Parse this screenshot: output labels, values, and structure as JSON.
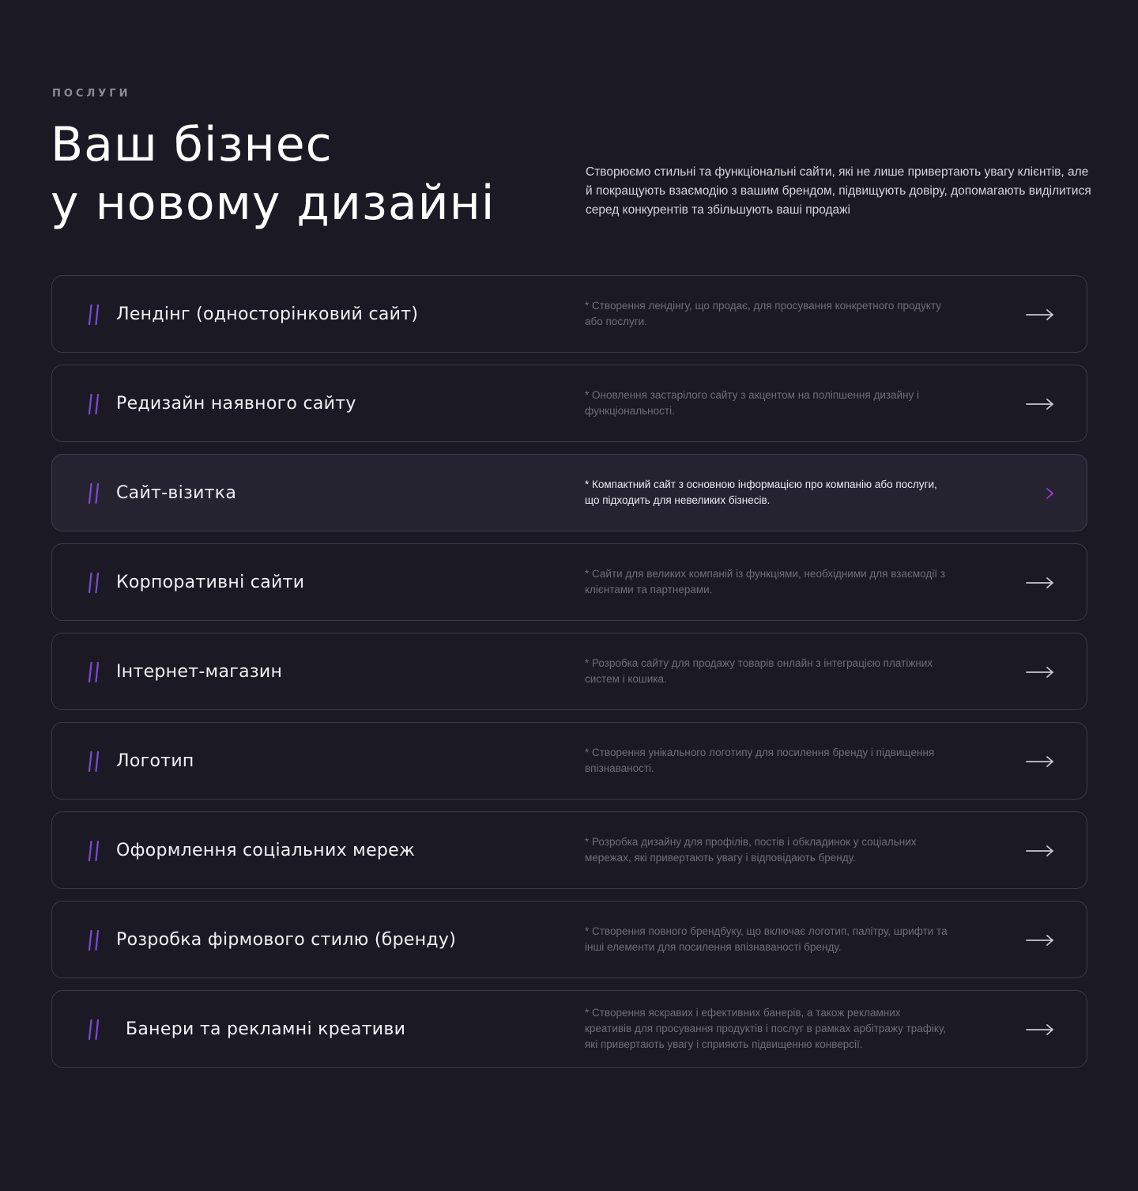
{
  "section": {
    "eyebrow": "ПОСЛУГИ",
    "title_line1": "Ваш бізнес",
    "title_line2": "у новому дизайні",
    "description": "Створюємо стильні та функціональні сайти, які не лише привертають увагу клієнтів, але й покращують взаємодію з вашим брендом, підвищують довіру, допомагають виділитися серед конкурентів та збільшують ваші продажі"
  },
  "colors": {
    "background": "#1b1a24",
    "card_border": "#3a3946",
    "card_active_bg": "#24232f",
    "hash_gradient_start": "#a53dd6",
    "hash_gradient_end": "#4a5ad8",
    "accent_arrow": "#b236e0"
  },
  "icons": {
    "bullet": "hash-icon",
    "action": "arrow-right-icon"
  },
  "services": [
    {
      "title": "Лендінг (односторінковий сайт)",
      "description": "* Створення лендінгу, що продає, для просування конкретного продукту або послуги.",
      "active": false
    },
    {
      "title": "Редизайн наявного сайту",
      "description": "* Оновлення застарілого сайту з акцентом на поліпшення дизайну і функціональності.",
      "active": false
    },
    {
      "title": "Сайт-візитка",
      "description": "* Компактний сайт з основною інформацією про компанію або послуги, що підходить для невеликих бізнесів.",
      "active": true
    },
    {
      "title": "Корпоративні сайти",
      "description": "* Сайти для великих компаній із функціями, необхідними для взаємодії з клієнтами та партнерами.",
      "active": false
    },
    {
      "title": "Інтернет-магазин",
      "description": "* Розробка сайту для продажу товарів онлайн з інтеграцією платіжних систем і кошика.",
      "active": false
    },
    {
      "title": "Логотип",
      "description": "* Створення унікального логотипу для посилення бренду і підвищення впізнаваності.",
      "active": false
    },
    {
      "title": "Оформлення соціальних мереж",
      "description": "* Розробка дизайну для профілів, постів і обкладинок у соціальних мережах, які привертають увагу і відповідають бренду.",
      "active": false
    },
    {
      "title": "Розробка фірмового стилю (бренду)",
      "description": "* Створення повного брендбуку, що включає логотип, палітру, шрифти та інші елементи для посилення впізнаваності бренду.",
      "active": false
    },
    {
      "title": "Банери та рекламні креативи",
      "description": "* Створення яскравих і ефективних банерів, а також рекламних креативів для просування продуктів і послуг в рамках арбітражу трафіку, які привертають увагу і сприяють підвищенню конверсії.",
      "active": false
    }
  ]
}
